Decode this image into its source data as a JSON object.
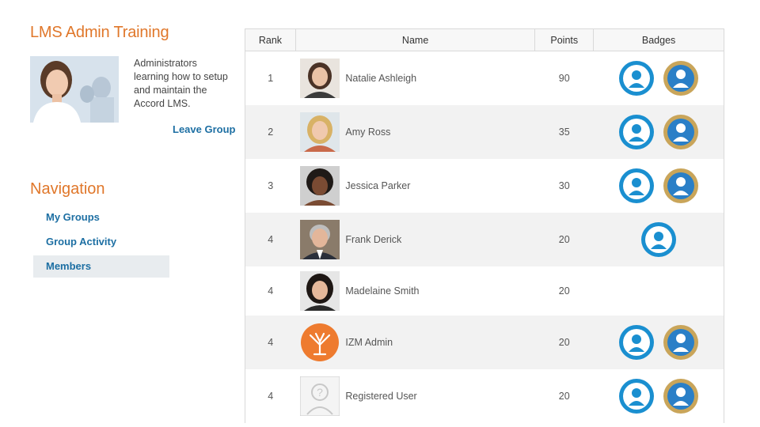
{
  "group": {
    "title": "LMS Admin Training",
    "description": "Administrators learning how to setup and maintain the Accord LMS.",
    "leave_label": "Leave Group"
  },
  "navigation": {
    "title": "Navigation",
    "items": [
      {
        "label": "My Groups",
        "active": false
      },
      {
        "label": "Group Activity",
        "active": false
      },
      {
        "label": "Members",
        "active": true
      }
    ]
  },
  "table": {
    "headers": {
      "rank": "Rank",
      "name": "Name",
      "points": "Points",
      "badges": "Badges"
    },
    "rows": [
      {
        "rank": "1",
        "name": "Natalie Ashleigh",
        "points": "90",
        "avatar": "photo-brunette-woman",
        "badges": [
          "blue-badge-icon",
          "gold-badge-icon"
        ]
      },
      {
        "rank": "2",
        "name": "Amy Ross",
        "points": "35",
        "avatar": "photo-blonde-woman",
        "badges": [
          "blue-badge-icon",
          "gold-badge-icon"
        ]
      },
      {
        "rank": "3",
        "name": "Jessica Parker",
        "points": "30",
        "avatar": "photo-dark-hair-woman",
        "badges": [
          "blue-badge-icon",
          "gold-badge-icon"
        ]
      },
      {
        "rank": "4",
        "name": "Frank Derick",
        "points": "20",
        "avatar": "photo-gray-hair-man",
        "badges": [
          "blue-badge-icon"
        ]
      },
      {
        "rank": "4",
        "name": "Madelaine Smith",
        "points": "20",
        "avatar": "photo-dark-hair-woman-2",
        "badges": []
      },
      {
        "rank": "4",
        "name": "IZM Admin",
        "points": "20",
        "avatar": "orange-tree-logo",
        "badges": [
          "blue-badge-icon",
          "gold-badge-icon"
        ]
      },
      {
        "rank": "4",
        "name": "Registered User",
        "points": "20",
        "avatar": "placeholder-user-icon",
        "badges": [
          "blue-badge-icon",
          "gold-badge-icon"
        ]
      }
    ]
  },
  "colors": {
    "accent_orange": "#e0772a",
    "link_blue": "#1d6fa3",
    "badge_blue": "#1a8fd0",
    "badge_gold": "#c9a55a"
  }
}
